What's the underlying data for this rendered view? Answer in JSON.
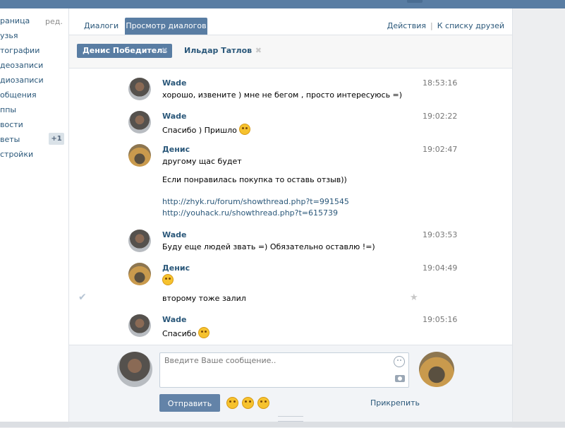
{
  "leftnav": {
    "items": [
      "раница",
      "узья",
      "тографии",
      "деозаписи",
      "диозаписи",
      "общения",
      "ппы",
      "вости",
      "веты",
      "стройки"
    ],
    "edit_label": "ред.",
    "badge": "+1"
  },
  "tabs": {
    "dialogs": "Диалоги",
    "view": "Просмотр диалогов",
    "actions": "Действия",
    "friends": "К списку друзей"
  },
  "chips": [
    {
      "name": "Денис Победитель",
      "close": "✖"
    },
    {
      "name": "Ильдар Татлов",
      "close": "✖"
    }
  ],
  "messages": [
    {
      "author": "Wade",
      "time": "18:53:16",
      "text": "хорошо, извените ) мне не бегом , просто интересуюсь =)"
    },
    {
      "author": "Wade",
      "time": "19:02:22",
      "text": "Спасибо ) Пришло"
    },
    {
      "author": "Денис",
      "time": "19:02:47",
      "lines": [
        "другому щас будет",
        "Если понравилась покупка то оставь отзыв))"
      ],
      "links": [
        "http://zhyk.ru/forum/showthread.php?t=991545",
        "http://youhack.ru/showthread.php?t=615739"
      ]
    },
    {
      "author": "Wade",
      "time": "19:03:53",
      "text": "Буду еще людей звать =) Обязательно оставлю !=)"
    },
    {
      "author": "Денис",
      "time": "19:04:49",
      "extra": "второму тоже залил"
    },
    {
      "author": "Wade",
      "time": "19:05:16",
      "text": "Спасибо"
    }
  ],
  "compose": {
    "placeholder": "Введите Ваше сообщение..",
    "send_label": "Отправить",
    "attach_label": "Прикрепить"
  },
  "icons": {
    "check": "✔",
    "star": "★"
  }
}
